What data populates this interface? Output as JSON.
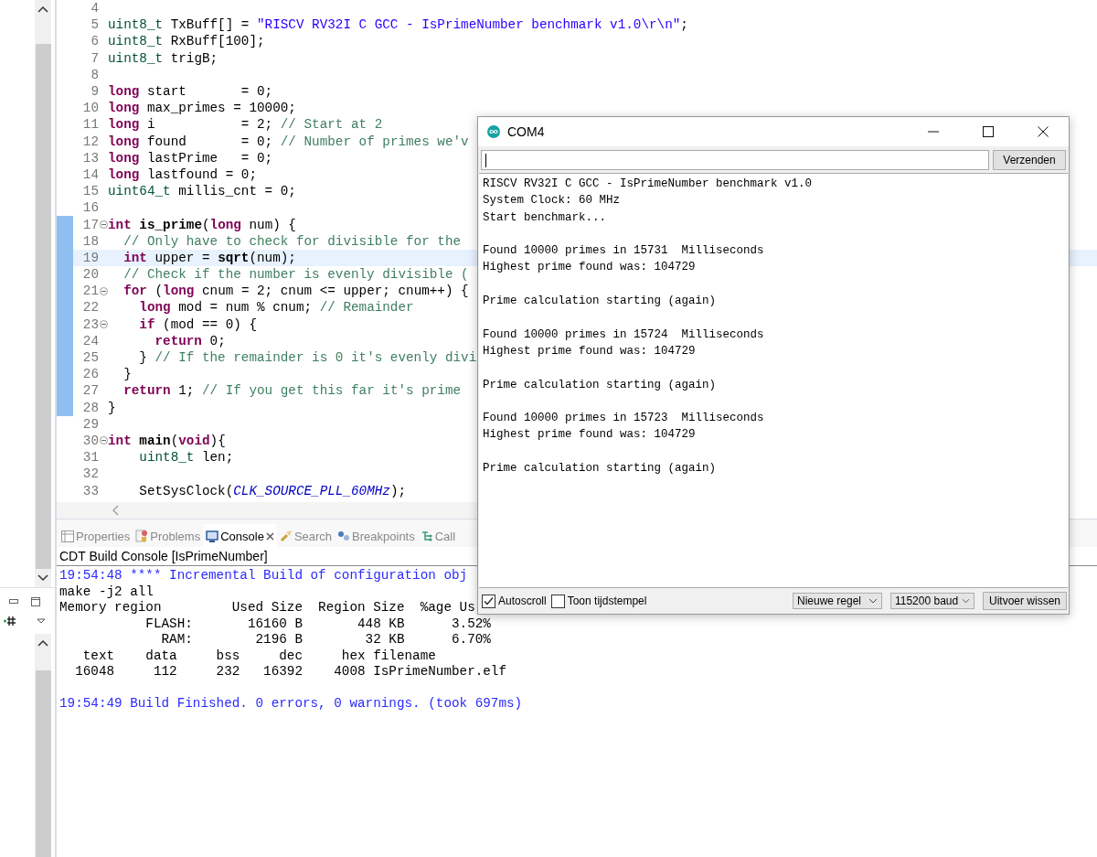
{
  "editor": {
    "lines": [
      {
        "num": "4",
        "marked": false,
        "current": false,
        "fold": false
      },
      {
        "num": "5",
        "marked": false,
        "current": false,
        "fold": false,
        "tokens": [
          {
            "kind": "type",
            "text": "uint8_t"
          },
          {
            "kind": "plain",
            "text": " TxBuff[] ="
          },
          {
            "kind": "str",
            "text": " \"RISCV RV32I C GCC - IsPrimeNumber benchmark v1.0\\r\\n\""
          },
          {
            "kind": "plain",
            "text": ";"
          }
        ]
      },
      {
        "num": "6",
        "marked": false,
        "current": false,
        "fold": false,
        "tokens": [
          {
            "kind": "type",
            "text": "uint8_t"
          },
          {
            "kind": "plain",
            "text": " RxBuff[100];"
          }
        ]
      },
      {
        "num": "7",
        "marked": false,
        "current": false,
        "fold": false,
        "tokens": [
          {
            "kind": "type",
            "text": "uint8_t"
          },
          {
            "kind": "plain",
            "text": " trigB;"
          }
        ]
      },
      {
        "num": "8",
        "marked": false,
        "current": false,
        "fold": false
      },
      {
        "num": "9",
        "marked": false,
        "current": false,
        "fold": false,
        "tokens": [
          {
            "kind": "kw",
            "text": "long"
          },
          {
            "kind": "plain",
            "text": " start       = 0;"
          }
        ]
      },
      {
        "num": "10",
        "marked": false,
        "current": false,
        "fold": false,
        "tokens": [
          {
            "kind": "kw",
            "text": "long"
          },
          {
            "kind": "plain",
            "text": " max_primes = 10000;"
          }
        ]
      },
      {
        "num": "11",
        "marked": false,
        "current": false,
        "fold": false,
        "tokens": [
          {
            "kind": "kw",
            "text": "long"
          },
          {
            "kind": "plain",
            "text": " i           = 2;"
          },
          {
            "kind": "comment",
            "text": " // Start at 2"
          }
        ]
      },
      {
        "num": "12",
        "marked": false,
        "current": false,
        "fold": false,
        "tokens": [
          {
            "kind": "kw",
            "text": "long"
          },
          {
            "kind": "plain",
            "text": " found       = 0;"
          },
          {
            "kind": "comment",
            "text": " // Number of primes we'v"
          }
        ]
      },
      {
        "num": "13",
        "marked": false,
        "current": false,
        "fold": false,
        "tokens": [
          {
            "kind": "kw",
            "text": "long"
          },
          {
            "kind": "plain",
            "text": " lastPrime   = 0;"
          }
        ]
      },
      {
        "num": "14",
        "marked": false,
        "current": false,
        "fold": false,
        "tokens": [
          {
            "kind": "kw",
            "text": "long"
          },
          {
            "kind": "plain",
            "text": " lastfound = 0;"
          }
        ]
      },
      {
        "num": "15",
        "marked": false,
        "current": false,
        "fold": false,
        "tokens": [
          {
            "kind": "type",
            "text": "uint64_t"
          },
          {
            "kind": "plain",
            "text": " millis_cnt = 0;"
          }
        ]
      },
      {
        "num": "16",
        "marked": false,
        "current": false,
        "fold": false
      },
      {
        "num": "17",
        "marked": true,
        "current": false,
        "fold": true,
        "tokens": [
          {
            "kind": "kw",
            "text": "int"
          },
          {
            "kind": "fn",
            "text": " is_prime"
          },
          {
            "kind": "plain",
            "text": "("
          },
          {
            "kind": "kw",
            "text": "long"
          },
          {
            "kind": "plain",
            "text": " num) {"
          }
        ]
      },
      {
        "num": "18",
        "marked": true,
        "current": false,
        "fold": false,
        "tokens": [
          {
            "kind": "comment",
            "text": "  // Only have to check for divisible for the"
          }
        ]
      },
      {
        "num": "19",
        "marked": true,
        "current": true,
        "fold": false,
        "tokens": [
          {
            "kind": "kw",
            "text": "  int"
          },
          {
            "kind": "plain",
            "text": " upper ="
          },
          {
            "kind": "fn",
            "text": " sqrt"
          },
          {
            "kind": "plain",
            "text": "(num);"
          }
        ]
      },
      {
        "num": "20",
        "marked": true,
        "current": false,
        "fold": false,
        "tokens": [
          {
            "kind": "comment",
            "text": "  // Check if the number is evenly divisible ("
          }
        ]
      },
      {
        "num": "21",
        "marked": true,
        "current": false,
        "fold": true,
        "tokens": [
          {
            "kind": "kw",
            "text": "  for"
          },
          {
            "kind": "plain",
            "text": " ("
          },
          {
            "kind": "kw",
            "text": "long"
          },
          {
            "kind": "plain",
            "text": " cnum = 2; cnum <= upper; cnum++) {"
          }
        ]
      },
      {
        "num": "22",
        "marked": true,
        "current": false,
        "fold": false,
        "tokens": [
          {
            "kind": "kw",
            "text": "    long"
          },
          {
            "kind": "plain",
            "text": " mod = num % cnum;"
          },
          {
            "kind": "comment",
            "text": " // Remainder"
          }
        ]
      },
      {
        "num": "23",
        "marked": true,
        "current": false,
        "fold": true,
        "tokens": [
          {
            "kind": "kw",
            "text": "    if"
          },
          {
            "kind": "plain",
            "text": " (mod == 0) {"
          }
        ]
      },
      {
        "num": "24",
        "marked": true,
        "current": false,
        "fold": false,
        "tokens": [
          {
            "kind": "kw",
            "text": "      return"
          },
          {
            "kind": "plain",
            "text": " 0;"
          }
        ]
      },
      {
        "num": "25",
        "marked": true,
        "current": false,
        "fold": false,
        "tokens": [
          {
            "kind": "plain",
            "text": "    }"
          },
          {
            "kind": "comment",
            "text": " // If the remainder is 0 it's evenly divi"
          }
        ]
      },
      {
        "num": "26",
        "marked": true,
        "current": false,
        "fold": false,
        "tokens": [
          {
            "kind": "plain",
            "text": "  }"
          }
        ]
      },
      {
        "num": "27",
        "marked": true,
        "current": false,
        "fold": false,
        "tokens": [
          {
            "kind": "kw",
            "text": "  return"
          },
          {
            "kind": "plain",
            "text": " 1;"
          },
          {
            "kind": "comment",
            "text": " // If you get this far it's prime"
          }
        ]
      },
      {
        "num": "28",
        "marked": true,
        "current": false,
        "fold": false,
        "tokens": [
          {
            "kind": "plain",
            "text": "}"
          }
        ]
      },
      {
        "num": "29",
        "marked": false,
        "current": false,
        "fold": false
      },
      {
        "num": "30",
        "marked": false,
        "current": false,
        "fold": true,
        "tokens": [
          {
            "kind": "kw",
            "text": "int"
          },
          {
            "kind": "fn",
            "text": " main"
          },
          {
            "kind": "plain",
            "text": "("
          },
          {
            "kind": "kw",
            "text": "void"
          },
          {
            "kind": "plain",
            "text": "){"
          }
        ]
      },
      {
        "num": "31",
        "marked": false,
        "current": false,
        "fold": false,
        "tokens": [
          {
            "kind": "type",
            "text": "    uint8_t"
          },
          {
            "kind": "plain",
            "text": " len;"
          }
        ]
      },
      {
        "num": "32",
        "marked": false,
        "current": false,
        "fold": false
      },
      {
        "num": "33",
        "marked": false,
        "current": false,
        "fold": false,
        "tokens": [
          {
            "kind": "plain",
            "text": "    SetSysClock("
          },
          {
            "kind": "macro",
            "text": "CLK_SOURCE_PLL_60MHz"
          },
          {
            "kind": "plain",
            "text": ");"
          }
        ]
      }
    ]
  },
  "panel": {
    "tabs": [
      {
        "label": "Properties",
        "kind": "properties",
        "selected": false
      },
      {
        "label": "Problems",
        "kind": "problems",
        "selected": false
      },
      {
        "label": "Console",
        "kind": "console",
        "selected": true
      },
      {
        "label": "Search",
        "kind": "search",
        "selected": false
      },
      {
        "label": "Breakpoints",
        "kind": "breakpoints",
        "selected": false
      },
      {
        "label": "Call",
        "kind": "call",
        "selected": false
      }
    ],
    "console_title": "CDT Build Console [IsPrimeNumber]",
    "console_lines": [
      {
        "kind": "info",
        "text": "19:54:48 **** Incremental Build of configuration obj"
      },
      {
        "kind": "plain",
        "text": "make -j2 all"
      },
      {
        "kind": "plain",
        "text": "Memory region         Used Size  Region Size  %age Us"
      },
      {
        "kind": "plain",
        "text": "           FLASH:       16160 B       448 KB      3.52%"
      },
      {
        "kind": "plain",
        "text": "             RAM:        2196 B        32 KB      6.70%"
      },
      {
        "kind": "plain",
        "text": "   text    data     bss     dec     hex filename"
      },
      {
        "kind": "plain",
        "text": "  16048     112     232   16392    4008 IsPrimeNumber.elf"
      },
      {
        "kind": "blank"
      },
      {
        "kind": "info",
        "text": "19:54:49 Build Finished. 0 errors, 0 warnings. (took 697ms)"
      }
    ]
  },
  "serial_monitor": {
    "title": "COM4",
    "send_button": "Verzenden",
    "output_blocks": [
      [
        "RISCV RV32I C GCC - IsPrimeNumber benchmark v1.0",
        "System Clock: 60 MHz",
        "Start benchmark..."
      ],
      [
        "Found 10000 primes in 15731  Milliseconds",
        "Highest prime found was: 104729"
      ],
      [
        "Prime calculation starting (again)"
      ],
      [
        "Found 10000 primes in 15724  Milliseconds",
        "Highest prime found was: 104729"
      ],
      [
        "Prime calculation starting (again)"
      ],
      [
        "Found 10000 primes in 15723  Milliseconds",
        "Highest prime found was: 104729"
      ],
      [
        "Prime calculation starting (again)"
      ]
    ],
    "autoscroll": {
      "label": "Autoscroll",
      "checked": true
    },
    "timestamp": {
      "label": "Toon tijdstempel",
      "checked": false
    },
    "line_ending": "Nieuwe regel",
    "baud": "115200 baud",
    "clear_button": "Uitvoer wissen"
  }
}
